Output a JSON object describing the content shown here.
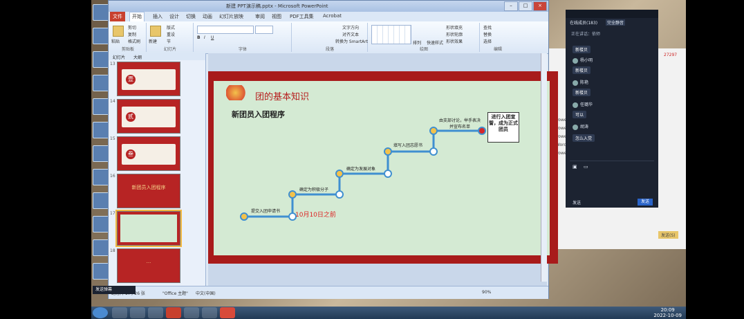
{
  "ppt": {
    "title": "新建 PPT演示稿.pptx - Microsoft PowerPoint",
    "tabs": [
      "文件",
      "开始",
      "插入",
      "设计",
      "切换",
      "动画",
      "幻灯片放映",
      "审阅",
      "视图",
      "PDF工具集",
      "Acrobat"
    ],
    "active_tab": "开始",
    "ribbon": {
      "clipboard": {
        "paste": "粘贴",
        "cut": "剪切",
        "copy": "复制",
        "painter": "格式刷",
        "label": "剪贴板"
      },
      "slides": {
        "new": "新建",
        "layout": "版式",
        "reset": "重设",
        "section": "节",
        "label": "幻灯片"
      },
      "font_label": "字体",
      "paragraph_label": "段落",
      "text_direction": "文字方向",
      "align_text": "对齐文本",
      "smartart": "转换为 SmartArt",
      "drawing": {
        "arrange": "排列",
        "quick_styles": "快速样式",
        "fill": "形状填充",
        "outline": "形状轮廓",
        "effects": "形状效果",
        "label": "绘图"
      },
      "editing": {
        "find": "查找",
        "replace": "替换",
        "select": "选择",
        "label": "编辑"
      }
    },
    "pane_tabs": [
      "幻灯片",
      "大纲"
    ],
    "thumbs": [
      {
        "num": "13",
        "text": "壹"
      },
      {
        "num": "14",
        "text": "贰"
      },
      {
        "num": "15",
        "text": "叁"
      },
      {
        "num": "16",
        "text": "新团员入团程序"
      },
      {
        "num": "17",
        "text": ""
      },
      {
        "num": "18",
        "text": "..."
      }
    ],
    "slide": {
      "title": "团的基本知识",
      "subtitle": "新团员入团程序",
      "steps": [
        "提交入团申请书",
        "确定为积极分子",
        "确定为发展对象",
        "填写入团志愿书",
        "由支部讨论，举手表决并宣布名单"
      ],
      "final": "进行入团宣誓，成为正式团员",
      "date": "10月10日之前"
    },
    "status": {
      "slide": "幻灯片 17 / 26 张",
      "theme": "\"Office 主题\"",
      "lang": "中文(中国)",
      "zoom": "90%"
    }
  },
  "chat": {
    "title": "在线成员(183)",
    "tab2": "完全静音",
    "speaking": "正在讲话：依师",
    "messages": [
      {
        "user": "",
        "text": "新楼贝"
      },
      {
        "user": "杨小明",
        "text": "新楼贝"
      },
      {
        "user": "陈艳",
        "text": "新楼贝"
      },
      {
        "user": "任璐华",
        "text": "可以"
      },
      {
        "user": "胡涛",
        "text": "怎么入党"
      }
    ],
    "footer_left": "发送",
    "send": "发送"
  },
  "bgwin": {
    "items": [
      "作 Power...",
      "作 Power...",
      "作 Power...",
      "作 Word ...",
      "作 Power..."
    ],
    "qq": "27297",
    "send_btn": "发送(S)"
  },
  "overlay": "发送弹幕",
  "clock": {
    "time": "20:09",
    "date": "2022-10-09"
  }
}
